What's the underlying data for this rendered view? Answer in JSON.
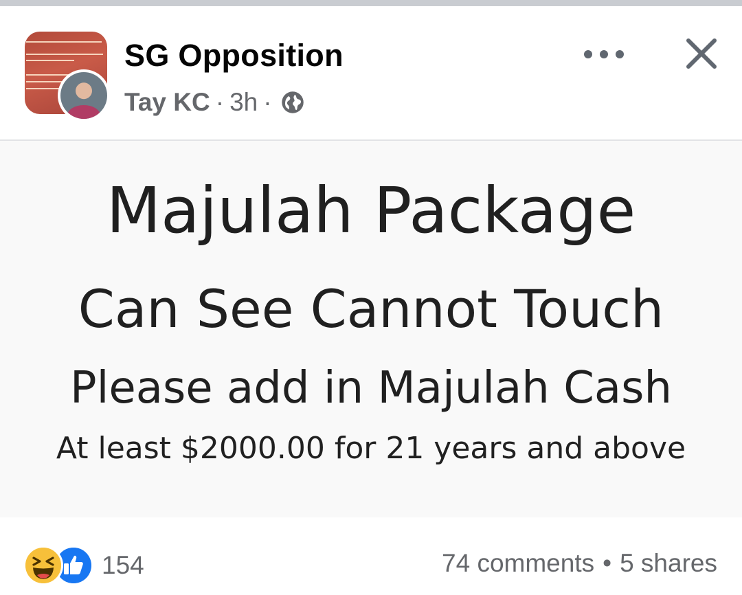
{
  "post": {
    "group_name": "SG Opposition",
    "author": "Tay KC",
    "separator": "·",
    "time": "3h",
    "privacy_icon": "globe-icon",
    "group_avatar_text": [
      "here... to SLAP the driver!",
      "off course or when he falls asleep",
      "drive dangerously...",
      "use if the driver is",
      "ble then just keep",
      "eep him a"
    ]
  },
  "actions": {
    "more_icon": "more-icon",
    "close_icon": "close-icon"
  },
  "image_text": {
    "line1": "Majulah Package",
    "line2": "Can See Cannot Touch",
    "line3": "Please add in Majulah Cash",
    "line4": "At least $2000.00 for 21 years and above"
  },
  "footer": {
    "reaction_icons": [
      "haha-icon",
      "like-icon"
    ],
    "reaction_count": "154",
    "comments": "74 comments",
    "bullet": "•",
    "shares": "5 shares"
  },
  "colors": {
    "meta_gray": "#65676b",
    "like_blue": "#1877f2",
    "haha_yellow": "#f7c03a"
  }
}
